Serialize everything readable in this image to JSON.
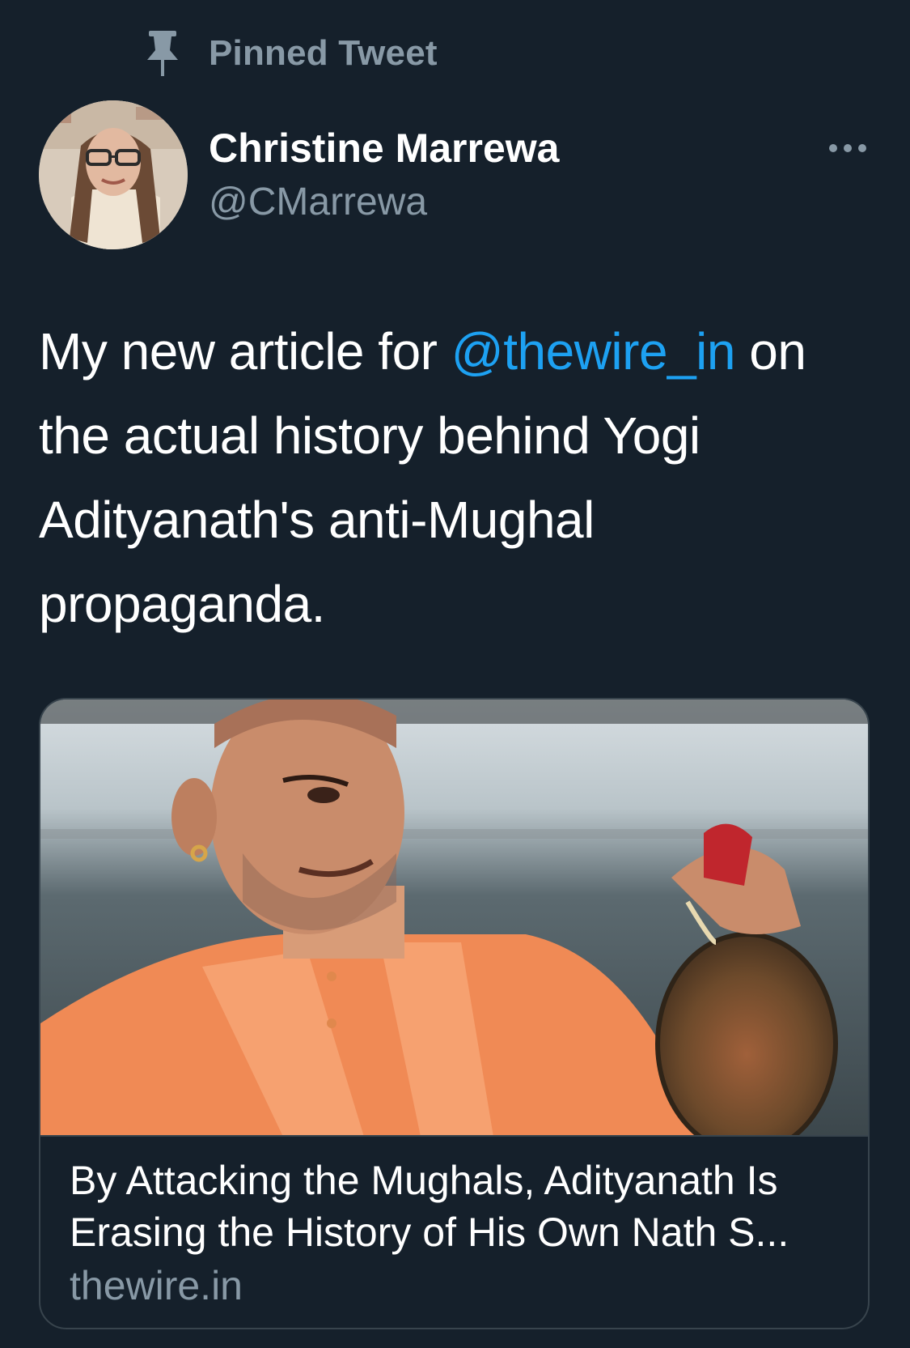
{
  "pinned": {
    "label": "Pinned Tweet",
    "icon": "pin-icon"
  },
  "author": {
    "display_name": "Christine Marrewa",
    "handle": "@CMarrewa"
  },
  "tweet": {
    "text_before": "My new article for ",
    "mention": "@thewire_in",
    "text_after": " on the actual history behind Yogi Adityanath's anti-Mughal propaganda."
  },
  "card": {
    "title": "By Attacking the Mughals, Adityanath Is Erasing the History of His Own Nath S...",
    "domain": "thewire.in"
  },
  "colors": {
    "background": "#15202b",
    "primary_text": "#ffffff",
    "secondary_text": "#8899a6",
    "link": "#1da1f2",
    "border": "#38444d"
  }
}
